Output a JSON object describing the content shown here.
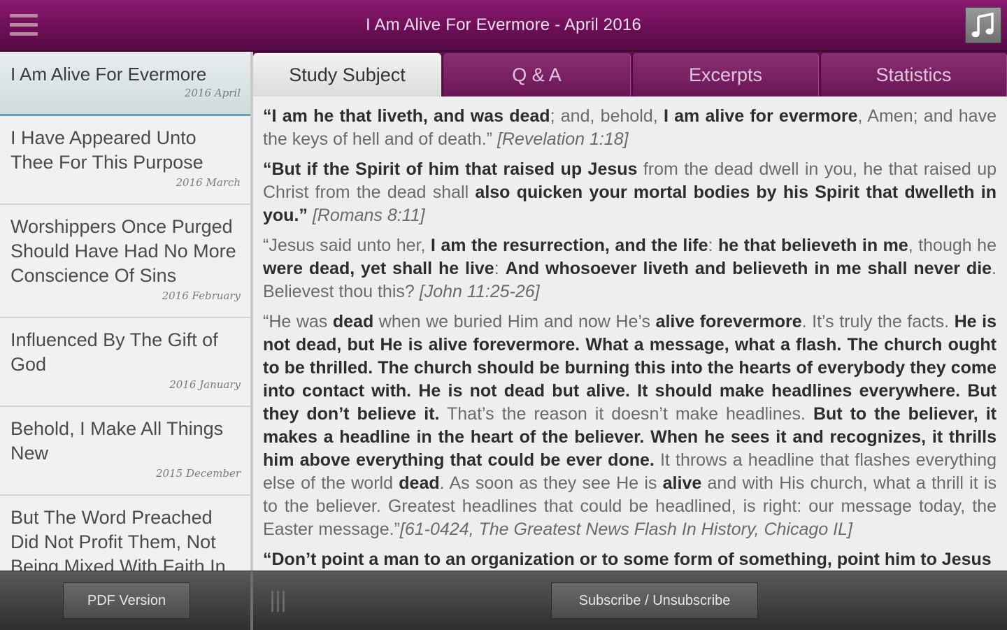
{
  "header": {
    "title": "I Am Alive For Evermore - April 2016",
    "menu_icon": "hamburger-menu-icon",
    "music_icon": "music-note-icon"
  },
  "sidebar": {
    "items": [
      {
        "title": "I Am Alive For Evermore",
        "date": "2016 April"
      },
      {
        "title": "I Have Appeared Unto Thee For This Purpose",
        "date": "2016 March"
      },
      {
        "title": "Worshippers Once Purged Should Have Had No More Conscience Of Sins",
        "date": "2016 February"
      },
      {
        "title": "Influenced By The Gift of God",
        "date": "2016 January"
      },
      {
        "title": "Behold, I Make All Things New",
        "date": "2015 December"
      },
      {
        "title": "But The Word Preached Did Not Profit Them, Not Being Mixed With Faith In",
        "date": ""
      }
    ]
  },
  "tabs": [
    {
      "label": "Study Subject"
    },
    {
      "label": "Q & A"
    },
    {
      "label": "Excerpts"
    },
    {
      "label": "Statistics"
    }
  ],
  "content": {
    "p1": {
      "b1": "“I am he that liveth, and was dead",
      "t1": "; and, behold, ",
      "b2": "I am alive for evermore",
      "t2": ", Amen; and have the keys of hell and of death.” ",
      "ref": "[Revelation 1:18]"
    },
    "p2": {
      "b1": "“But if the Spirit of him that raised up Jesus",
      "t1": " from the dead dwell in you, he that raised up Christ from the dead shall ",
      "b2": "also quicken your mortal bodies by his Spirit that dwelleth in you.”",
      "ref": " [Romans 8:11]"
    },
    "p3": {
      "t1": "“Jesus said unto her, ",
      "b1": "I am the resurrection, and the life",
      "t2": ": ",
      "b2": "he that believeth in me",
      "t3": ", though he ",
      "b3": "were dead, yet shall he live",
      "t4": ": ",
      "b4": "And whosoever liveth and believeth in me shall never die",
      "t5": ". Believest thou this? ",
      "ref": "[John 11:25-26]"
    },
    "p4": {
      "t1": "“He was ",
      "b1": "dead",
      "t2": " when we buried Him and now He’s ",
      "b2": "alive forevermore",
      "t3": ". It’s truly the facts. ",
      "b3": "He is not dead, but He is alive forevermore. What a message, what a flash. The church ought to be thrilled. The church should be burning this into the hearts of everybody they come into contact with. He is not dead but alive. It should make headlines everywhere. But they don’t believe it.",
      "t4": " That’s the reason it doesn’t make headlines. ",
      "b4": "But to the believer, it makes a headline in the heart of the believer. When he sees it and recognizes, it thrills him above everything that could be ever done.",
      "t5": " It throws a headline that flashes everything else of the world ",
      "b5": "dead",
      "t6": ". As soon as they see He is ",
      "b6": "alive",
      "t7": " and with His church, what a thrill it is to the believer. Greatest headlines that could be headlined, is right: our message today, the Easter message.”",
      "ref": "[61-0424, The Greatest News Flash In History, Chicago IL]"
    },
    "p5": {
      "b1": "“Don’t point a man to an organization or to some form of something, point him to Jesus"
    }
  },
  "footer": {
    "pdf_label": "PDF Version",
    "subscribe_label": "Subscribe / Unsubscribe"
  }
}
